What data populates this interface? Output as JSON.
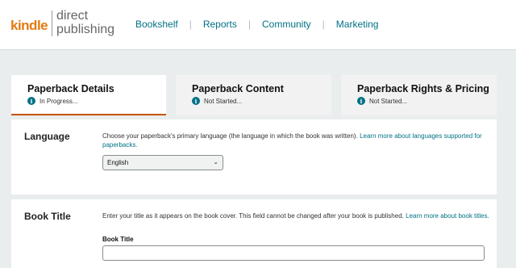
{
  "logo": {
    "brand": "kindle",
    "line1": "direct",
    "line2": "publishing"
  },
  "nav": {
    "items": [
      "Bookshelf",
      "Reports",
      "Community",
      "Marketing"
    ]
  },
  "tabs": [
    {
      "title": "Paperback Details",
      "status": "In Progress..."
    },
    {
      "title": "Paperback Content",
      "status": "Not Started..."
    },
    {
      "title": "Paperback Rights & Pricing",
      "status": "Not Started..."
    }
  ],
  "language": {
    "label": "Language",
    "description": "Choose your paperback's primary language (the language in which the book was written).",
    "link": "Learn more about languages supported for paperbacks.",
    "selected": "English"
  },
  "book_title": {
    "label": "Book Title",
    "description": "Enter your title as it appears on the book cover. This field cannot be changed after your book is published.",
    "link": "Learn more about book titles.",
    "field_label": "Book Title",
    "value": ""
  },
  "colors": {
    "accent": "#e47911",
    "link": "#007185",
    "active_tab": "#c45500",
    "background": "#eaeded"
  },
  "icons": {
    "info": "info-icon",
    "dropdown": "chevron-down-icon"
  }
}
